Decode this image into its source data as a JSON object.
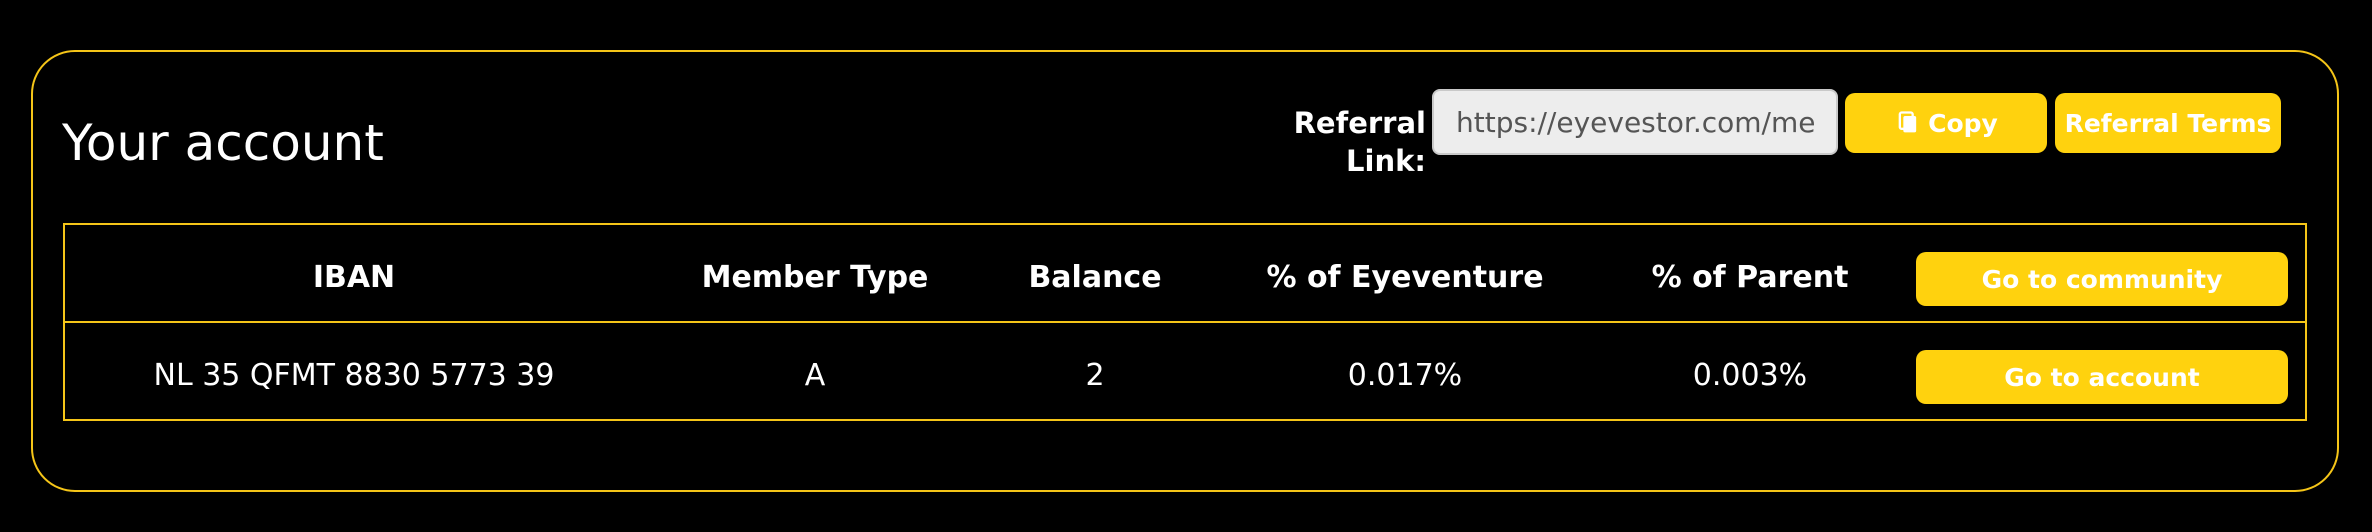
{
  "title": "Your account",
  "referral": {
    "label": "Referral Link:",
    "value": "https://eyevestor.com/me",
    "copy_label": "Copy",
    "terms_label": "Referral Terms"
  },
  "table": {
    "headers": {
      "iban": "IBAN",
      "member_type": "Member Type",
      "balance": "Balance",
      "pct_eyeventure": "% of Eyeventure",
      "pct_parent": "% of Parent",
      "action": "Go to community"
    },
    "rows": [
      {
        "iban": "NL 35 QFMT 8830 5773 39",
        "member_type": "A",
        "balance": "2",
        "pct_eyeventure": "0.017%",
        "pct_parent": "0.003%",
        "action": "Go to account"
      }
    ]
  },
  "colors": {
    "accent": "#ffd20e",
    "border": "#f5c518",
    "background": "#000000",
    "text": "#ffffff"
  }
}
